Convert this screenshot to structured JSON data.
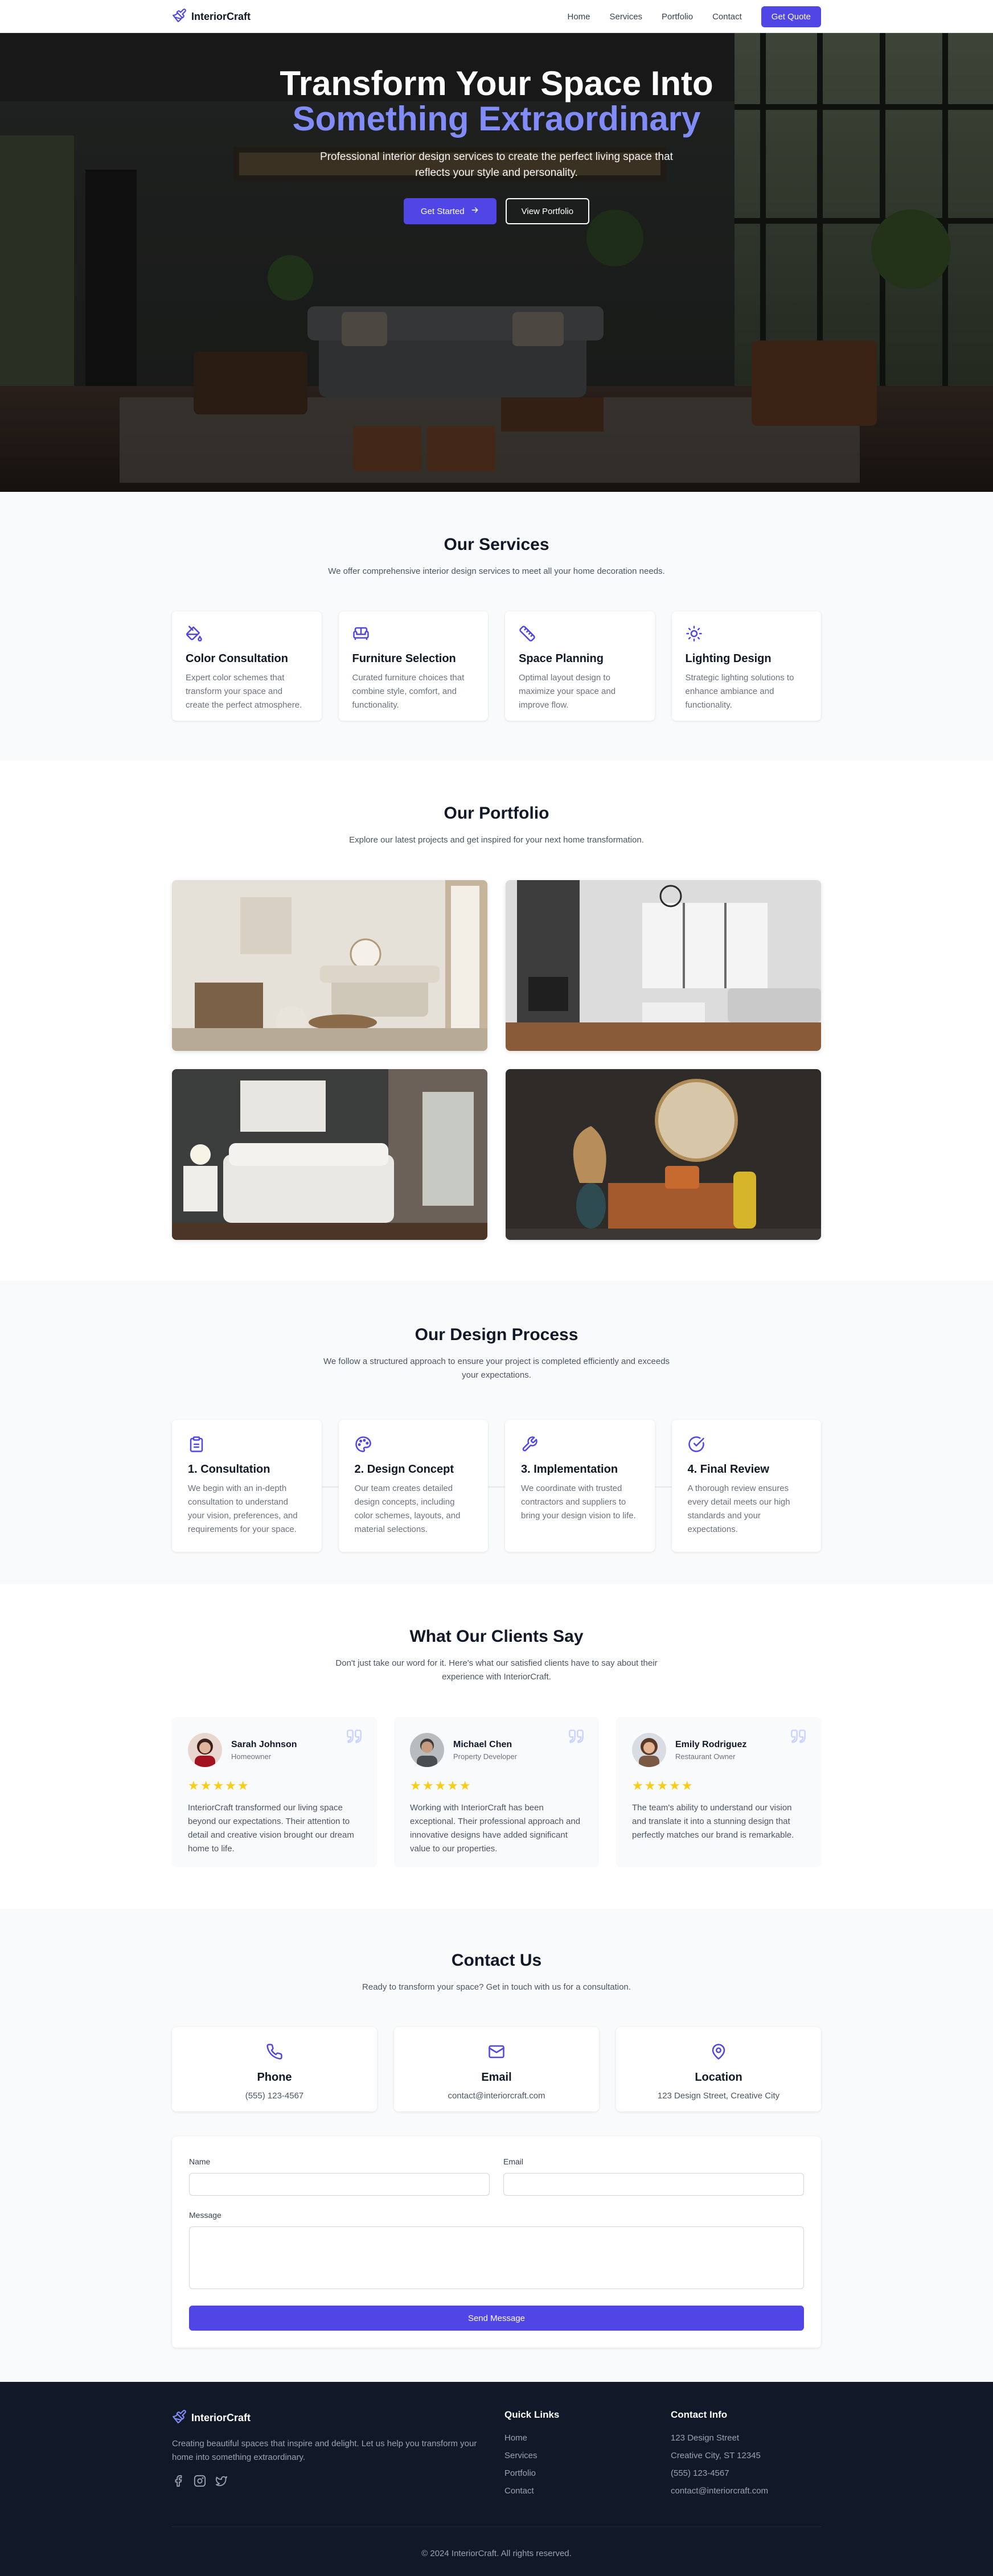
{
  "nav": {
    "brand": "InteriorCraft",
    "links": [
      "Home",
      "Services",
      "Portfolio",
      "Contact"
    ],
    "cta": "Get Quote"
  },
  "hero": {
    "title_line1": "Transform Your Space Into",
    "title_line2": "Something Extraordinary",
    "subtitle": "Professional interior design services to create the perfect living space that reflects your style and personality.",
    "primary_button": "Get Started",
    "secondary_button": "View Portfolio"
  },
  "services": {
    "title": "Our Services",
    "subtitle": "We offer comprehensive interior design services to meet all your home decoration needs.",
    "items": [
      {
        "icon": "paint-bucket-icon",
        "title": "Color Consultation",
        "text": "Expert color schemes that transform your space and create the perfect atmosphere."
      },
      {
        "icon": "sofa-icon",
        "title": "Furniture Selection",
        "text": "Curated furniture choices that combine style, comfort, and functionality."
      },
      {
        "icon": "ruler-icon",
        "title": "Space Planning",
        "text": "Optimal layout design to maximize your space and improve flow."
      },
      {
        "icon": "sun-icon",
        "title": "Lighting Design",
        "text": "Strategic lighting solutions to enhance ambiance and functionality."
      }
    ]
  },
  "portfolio": {
    "title": "Our Portfolio",
    "subtitle": "Explore our latest projects and get inspired for your next home transformation."
  },
  "process": {
    "title": "Our Design Process",
    "subtitle": "We follow a structured approach to ensure your project is completed efficiently and exceeds your expectations.",
    "steps": [
      {
        "icon": "clipboard-icon",
        "title": "1. Consultation",
        "text": "We begin with an in-depth consultation to understand your vision, preferences, and requirements for your space."
      },
      {
        "icon": "palette-icon",
        "title": "2. Design Concept",
        "text": "Our team creates detailed design concepts, including color schemes, layouts, and material selections."
      },
      {
        "icon": "wrench-icon",
        "title": "3. Implementation",
        "text": "We coordinate with trusted contractors and suppliers to bring your design vision to life."
      },
      {
        "icon": "check-circle-icon",
        "title": "4. Final Review",
        "text": "A thorough review ensures every detail meets our high standards and your expectations."
      }
    ]
  },
  "testimonials": {
    "title": "What Our Clients Say",
    "subtitle": "Don't just take our word for it. Here's what our satisfied clients have to say about their experience with InteriorCraft.",
    "rating": 5,
    "stars": "★★★★★",
    "items": [
      {
        "name": "Sarah Johnson",
        "role": "Homeowner",
        "text": "InteriorCraft transformed our living space beyond our expectations. Their attention to detail and creative vision brought our dream home to life."
      },
      {
        "name": "Michael Chen",
        "role": "Property Developer",
        "text": "Working with InteriorCraft has been exceptional. Their professional approach and innovative designs have added significant value to our properties."
      },
      {
        "name": "Emily Rodriguez",
        "role": "Restaurant Owner",
        "text": "The team's ability to understand our vision and translate it into a stunning design that perfectly matches our brand is remarkable."
      }
    ]
  },
  "contact": {
    "title": "Contact Us",
    "subtitle": "Ready to transform your space? Get in touch with us for a consultation.",
    "cards": [
      {
        "icon": "phone-icon",
        "title": "Phone",
        "value": "(555) 123-4567"
      },
      {
        "icon": "mail-icon",
        "title": "Email",
        "value": "contact@interiorcraft.com"
      },
      {
        "icon": "map-pin-icon",
        "title": "Location",
        "value": "123 Design Street, Creative City"
      }
    ],
    "form": {
      "name_label": "Name",
      "email_label": "Email",
      "message_label": "Message",
      "submit": "Send Message"
    }
  },
  "footer": {
    "brand": "InteriorCraft",
    "description": "Creating beautiful spaces that inspire and delight. Let us help you transform your home into something extraordinary.",
    "social": [
      "facebook-icon",
      "instagram-icon",
      "twitter-icon"
    ],
    "quick_links_title": "Quick Links",
    "quick_links": [
      "Home",
      "Services",
      "Portfolio",
      "Contact"
    ],
    "contact_title": "Contact Info",
    "contact_lines": [
      "123 Design Street",
      "Creative City, ST 12345",
      "(555) 123-4567",
      "contact@interiorcraft.com"
    ],
    "copyright": "© 2024 InteriorCraft. All rights reserved."
  },
  "colors": {
    "primary": "#4f46e5",
    "primary_light": "#818cf8",
    "dark": "#111827",
    "muted": "#6b7280",
    "star": "#facc15",
    "section_gray": "#f9fafb"
  }
}
